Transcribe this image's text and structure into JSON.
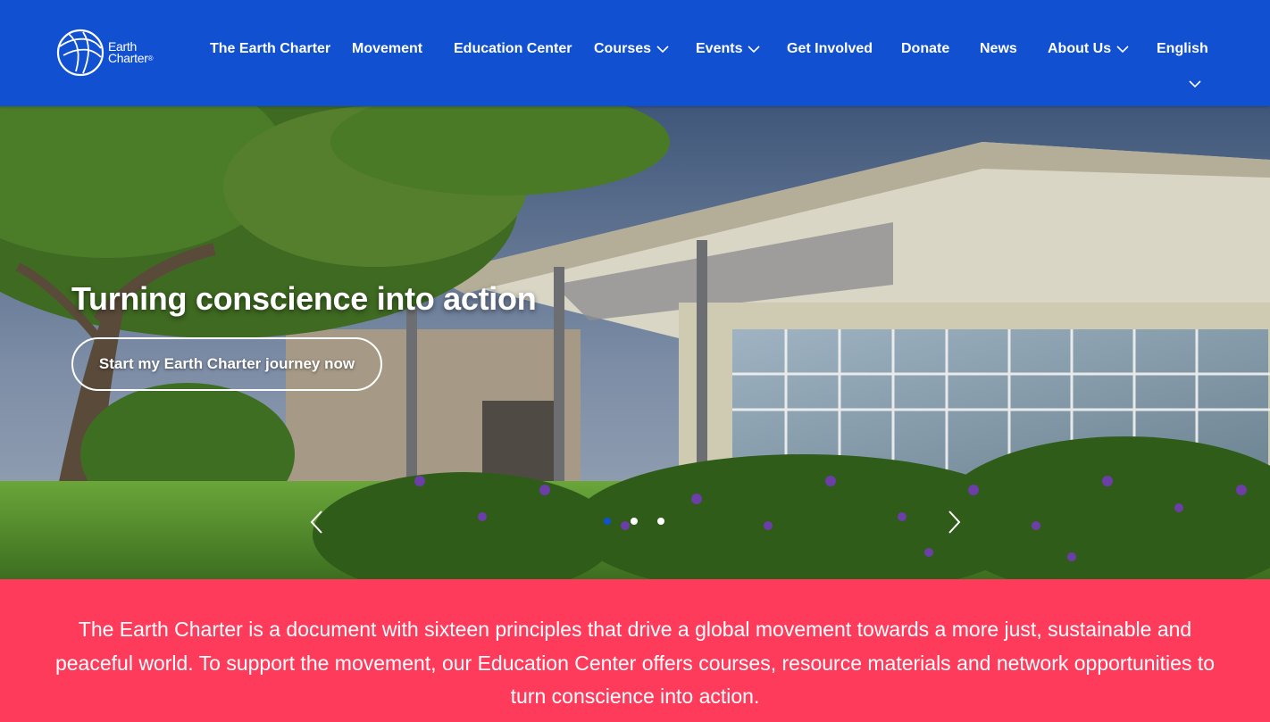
{
  "brand": {
    "logo_line1": "Earth",
    "logo_line2": "Charter",
    "logo_mark": "®"
  },
  "nav": {
    "items": [
      {
        "label": "The Earth Charter"
      },
      {
        "label": "Movement"
      },
      {
        "label": "Education Center"
      },
      {
        "label": "Courses",
        "dropdown": true
      },
      {
        "label": "Events",
        "dropdown": true
      },
      {
        "label": "Get Involved"
      },
      {
        "label": "Donate"
      },
      {
        "label": "News"
      },
      {
        "label": "About Us",
        "dropdown": true
      },
      {
        "label": "English",
        "dropdown": true
      }
    ]
  },
  "hero": {
    "title": "Turning conscience into action",
    "cta_label": "Start my Earth Charter journey now",
    "slides_count": 3,
    "active_slide": 1
  },
  "intro": {
    "text": "The Earth Charter is a document with sixteen principles that drive a global movement towards a more just, sustainable and peaceful world. To support the movement, our Education Center offers courses, resource materials and network opportunities to turn conscience into action."
  },
  "colors": {
    "nav_bg": "#1150d1",
    "intro_bg": "#ff3b5c",
    "text": "#ffffff"
  }
}
